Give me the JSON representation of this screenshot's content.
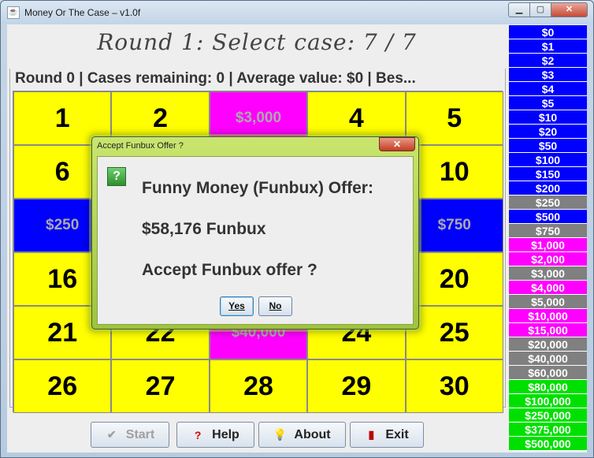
{
  "window": {
    "title": "Money Or The Case – v1.0f",
    "close_glyph": "✕",
    "min_glyph": "▁",
    "max_glyph": "▢"
  },
  "round_title": "Round 1: Select case: 7 / 7",
  "status_line": "Round 0  |  Cases remaining: 0  |  Average value: $0  |  Bes...",
  "grid": [
    {
      "text": "1",
      "kind": "case",
      "bg": "#ffff00"
    },
    {
      "text": "2",
      "kind": "case",
      "bg": "#ffff00"
    },
    {
      "text": "$3,000",
      "kind": "opened",
      "bg": "#ff00ff"
    },
    {
      "text": "4",
      "kind": "case",
      "bg": "#ffff00"
    },
    {
      "text": "5",
      "kind": "case",
      "bg": "#ffff00"
    },
    {
      "text": "6",
      "kind": "case",
      "bg": "#ffff00"
    },
    {
      "text": "",
      "kind": "hidden",
      "bg": "#ffff00"
    },
    {
      "text": "",
      "kind": "hidden",
      "bg": "#ffff00"
    },
    {
      "text": "",
      "kind": "hidden",
      "bg": "#ffff00"
    },
    {
      "text": "10",
      "kind": "case",
      "bg": "#ffff00"
    },
    {
      "text": "$250",
      "kind": "opened",
      "bg": "#0000ff"
    },
    {
      "text": "",
      "kind": "hidden",
      "bg": "#0000ff"
    },
    {
      "text": "",
      "kind": "hidden",
      "bg": "#0000ff"
    },
    {
      "text": "",
      "kind": "hidden",
      "bg": "#0000ff"
    },
    {
      "text": "$750",
      "kind": "opened",
      "bg": "#0000ff"
    },
    {
      "text": "16",
      "kind": "case",
      "bg": "#ffff00"
    },
    {
      "text": "",
      "kind": "hidden",
      "bg": "#ffff00"
    },
    {
      "text": "",
      "kind": "hidden",
      "bg": "#ffff00"
    },
    {
      "text": "",
      "kind": "hidden",
      "bg": "#ffff00"
    },
    {
      "text": "20",
      "kind": "case",
      "bg": "#ffff00"
    },
    {
      "text": "21",
      "kind": "case",
      "bg": "#ffff00"
    },
    {
      "text": "22",
      "kind": "case",
      "bg": "#ffff00"
    },
    {
      "text": "$40,000",
      "kind": "opened",
      "bg": "#ff00ff"
    },
    {
      "text": "24",
      "kind": "case",
      "bg": "#ffff00"
    },
    {
      "text": "25",
      "kind": "case",
      "bg": "#ffff00"
    },
    {
      "text": "26",
      "kind": "case",
      "bg": "#ffff00"
    },
    {
      "text": "27",
      "kind": "case",
      "bg": "#ffff00"
    },
    {
      "text": "28",
      "kind": "case",
      "bg": "#ffff00"
    },
    {
      "text": "29",
      "kind": "case",
      "bg": "#ffff00"
    },
    {
      "text": "30",
      "kind": "case",
      "bg": "#ffff00"
    }
  ],
  "buttons": {
    "start": {
      "label": "Start",
      "icon": "✔"
    },
    "help": {
      "label": "Help",
      "icon": "?"
    },
    "about": {
      "label": "About",
      "icon": "💡"
    },
    "exit": {
      "label": "Exit",
      "icon": "▮"
    }
  },
  "money_ladder": [
    {
      "value": "$0",
      "color": "#0000ff"
    },
    {
      "value": "$1",
      "color": "#0000ff"
    },
    {
      "value": "$2",
      "color": "#0000ff"
    },
    {
      "value": "$3",
      "color": "#0000ff"
    },
    {
      "value": "$4",
      "color": "#0000ff"
    },
    {
      "value": "$5",
      "color": "#0000ff"
    },
    {
      "value": "$10",
      "color": "#0000ff"
    },
    {
      "value": "$20",
      "color": "#0000ff"
    },
    {
      "value": "$50",
      "color": "#0000ff"
    },
    {
      "value": "$100",
      "color": "#0000ff"
    },
    {
      "value": "$150",
      "color": "#0000ff"
    },
    {
      "value": "$200",
      "color": "#0000ff"
    },
    {
      "value": "$250",
      "color": "#808080"
    },
    {
      "value": "$500",
      "color": "#0000ff"
    },
    {
      "value": "$750",
      "color": "#808080"
    },
    {
      "value": "$1,000",
      "color": "#ff00ff"
    },
    {
      "value": "$2,000",
      "color": "#ff00ff"
    },
    {
      "value": "$3,000",
      "color": "#808080"
    },
    {
      "value": "$4,000",
      "color": "#ff00ff"
    },
    {
      "value": "$5,000",
      "color": "#808080"
    },
    {
      "value": "$10,000",
      "color": "#ff00ff"
    },
    {
      "value": "$15,000",
      "color": "#ff00ff"
    },
    {
      "value": "$20,000",
      "color": "#808080"
    },
    {
      "value": "$40,000",
      "color": "#808080"
    },
    {
      "value": "$60,000",
      "color": "#808080"
    },
    {
      "value": "$80,000",
      "color": "#00e000"
    },
    {
      "value": "$100,000",
      "color": "#00e000"
    },
    {
      "value": "$250,000",
      "color": "#00e000"
    },
    {
      "value": "$375,000",
      "color": "#00e000"
    },
    {
      "value": "$500,000",
      "color": "#00e000"
    }
  ],
  "dialog": {
    "title": "Accept Funbux Offer ?",
    "icon": "?",
    "line1": "Funny Money (Funbux) Offer:",
    "line2": "$58,176 Funbux",
    "line3": "Accept Funbux offer ?",
    "yes_label": "Yes",
    "no_label": "No",
    "close_glyph": "✕"
  }
}
